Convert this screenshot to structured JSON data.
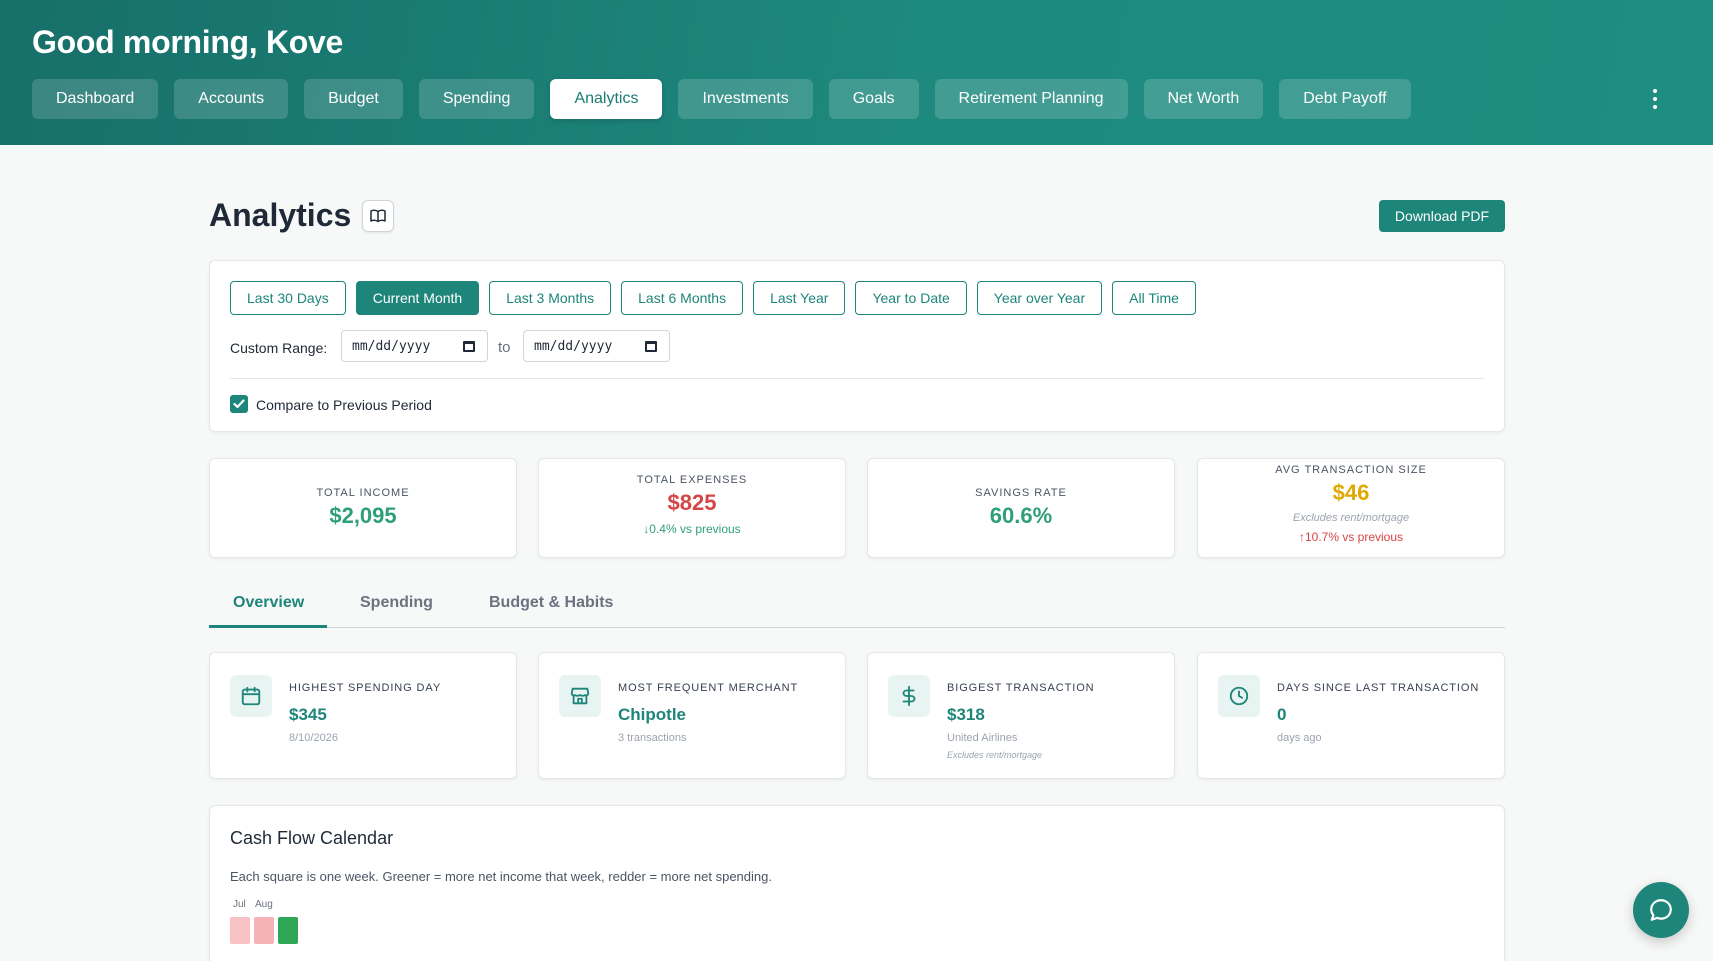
{
  "header": {
    "greeting": "Good morning, Kove",
    "nav": [
      {
        "label": "Dashboard"
      },
      {
        "label": "Accounts"
      },
      {
        "label": "Budget"
      },
      {
        "label": "Spending"
      },
      {
        "label": "Analytics",
        "active": true
      },
      {
        "label": "Investments"
      },
      {
        "label": "Goals"
      },
      {
        "label": "Retirement Planning"
      },
      {
        "label": "Net Worth"
      },
      {
        "label": "Debt Payoff"
      }
    ],
    "more_icon": "kebab-menu-icon"
  },
  "page": {
    "title": "Analytics",
    "guide_icon": "book-open-icon",
    "download_label": "Download PDF"
  },
  "filters": {
    "ranges": [
      {
        "label": "Last 30 Days"
      },
      {
        "label": "Current Month",
        "active": true
      },
      {
        "label": "Last 3 Months"
      },
      {
        "label": "Last 6 Months"
      },
      {
        "label": "Last Year"
      },
      {
        "label": "Year to Date"
      },
      {
        "label": "Year over Year"
      },
      {
        "label": "All Time"
      }
    ],
    "custom_label": "Custom Range:",
    "start_placeholder": "mm/dd/yyyy",
    "to_label": "to",
    "end_placeholder": "mm/dd/yyyy",
    "compare_label": "Compare to Previous Period",
    "compare_checked": true
  },
  "stats": {
    "income": {
      "label": "TOTAL INCOME",
      "value": "$2,095",
      "color": "#2f9e7a"
    },
    "expenses": {
      "label": "TOTAL EXPENSES",
      "value": "$825",
      "delta": "↓0.4% vs previous",
      "color": "#d64545",
      "delta_color": "#2f9e7a"
    },
    "savings": {
      "label": "SAVINGS RATE",
      "value": "60.6%",
      "color": "#2f9e7a"
    },
    "avg": {
      "label": "AVG TRANSACTION SIZE",
      "value": "$46",
      "note": "Excludes rent/mortgage",
      "delta": "↑10.7% vs previous",
      "color": "#e0a800",
      "delta_color": "#d64545"
    }
  },
  "tabs": [
    {
      "label": "Overview",
      "active": true
    },
    {
      "label": "Spending"
    },
    {
      "label": "Budget & Habits"
    }
  ],
  "insights": {
    "highest_day": {
      "label": "HIGHEST SPENDING DAY",
      "value": "$345",
      "sub": "8/10/2026",
      "icon": "calendar-icon"
    },
    "merchant": {
      "label": "MOST FREQUENT MERCHANT",
      "value": "Chipotle",
      "sub": "3 transactions",
      "icon": "store-icon"
    },
    "biggest": {
      "label": "BIGGEST TRANSACTION",
      "value": "$318",
      "sub": "United Airlines",
      "note": "Excludes rent/mortgage",
      "icon": "dollar-icon"
    },
    "days_since": {
      "label": "DAYS SINCE LAST TRANSACTION",
      "value": "0",
      "sub": "days ago",
      "icon": "clock-icon"
    }
  },
  "calendar": {
    "title": "Cash Flow Calendar",
    "description": "Each square is one week. Greener = more net income that week, redder = more net spending.",
    "months": [
      "Jul",
      "Aug"
    ],
    "weeks": [
      {
        "color": "#f8c2c4"
      },
      {
        "color": "#f5b3b6"
      },
      {
        "color": "#2fa756"
      }
    ]
  },
  "chat": {
    "icon": "chat-bubble-icon"
  }
}
